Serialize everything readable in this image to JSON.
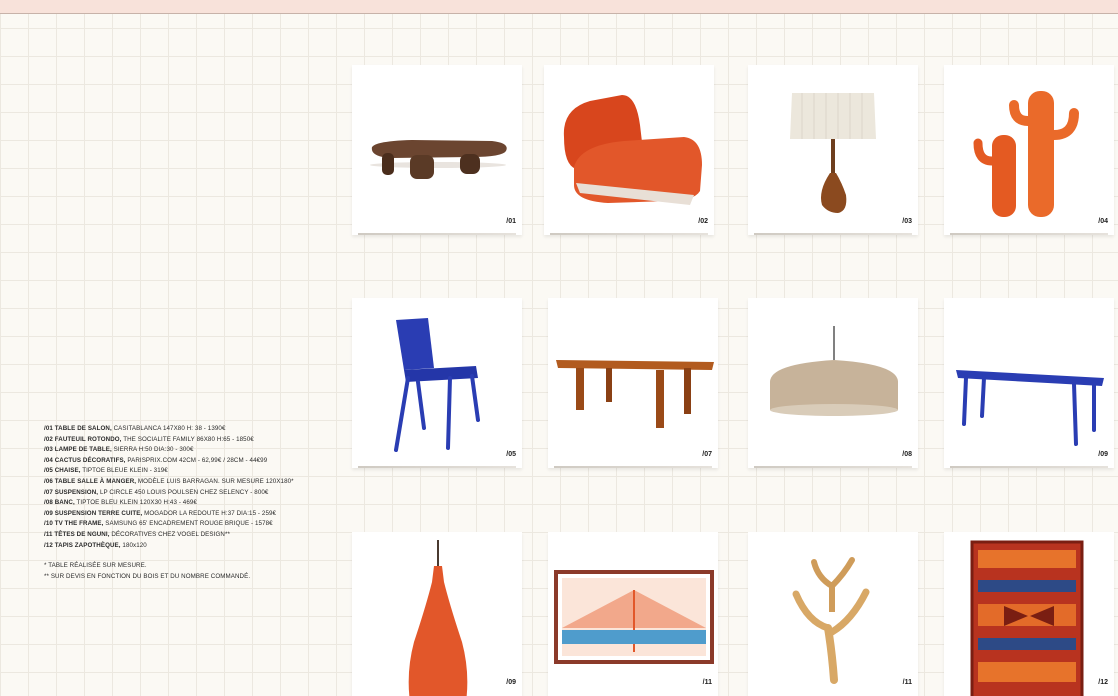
{
  "products": [
    {
      "num": "/01",
      "icon": "coffee-table-icon"
    },
    {
      "num": "/02",
      "icon": "armchair-icon"
    },
    {
      "num": "/03",
      "icon": "table-lamp-icon"
    },
    {
      "num": "/04",
      "icon": "cactus-decor-icon"
    },
    {
      "num": "/05",
      "icon": "chair-icon"
    },
    {
      "num": "/07",
      "icon": "dining-table-icon"
    },
    {
      "num": "/08",
      "icon": "pendant-lamp-icon"
    },
    {
      "num": "/09",
      "icon": "bench-icon"
    },
    {
      "num": "/09",
      "icon": "terracotta-pendant-icon"
    },
    {
      "num": "/11",
      "icon": "tv-frame-icon"
    },
    {
      "num": "/11",
      "icon": "nguni-horns-icon"
    },
    {
      "num": "/12",
      "icon": "zapotec-rug-icon"
    }
  ],
  "legend": [
    {
      "bold": "/01 TABLE DE SALON,",
      "text": " CASITABLANCA 147X80 H: 38 - 1390€"
    },
    {
      "bold": "/02 FAUTEUIL ROTONDO,",
      "text": " THE SOCIALITE FAMILY 86X80 H:65 - 1850€"
    },
    {
      "bold": "/03 LAMPE DE TABLE,",
      "text": " SIERRA H:50 DIA:30 - 300€"
    },
    {
      "bold": "/04 CACTUS DÉCORATIFS,",
      "text": " PARISPRIX.COM 42CM - 62,99€ / 28CM - 44€99"
    },
    {
      "bold": "/05 CHAISE,",
      "text": " TIPTOE BLEUE KLEIN - 319€"
    },
    {
      "bold": "/06 TABLE SALLE À MANGER,",
      "text": " MODÈLE LUIS BARRAGAN. SUR MESURE 120X180*"
    },
    {
      "bold": "/07 SUSPENSION,",
      "text": " LP CIRCLE 450 LOUIS POULSEN CHEZ SELENCY - 800€"
    },
    {
      "bold": "/08 BANC,",
      "text": " TIPTOE BLEU KLEIN 120X30 H:43 - 469€"
    },
    {
      "bold": "/09 SUSPENSION TERRE CUITE,",
      "text": " MOGADOR  LA REDOUTE H:37 DIA:15 - 259€"
    },
    {
      "bold": "/10 TV THE FRAME,",
      "text": " SAMSUNG 65' ENCADREMENT ROUGE BRIQUE - 1578€"
    },
    {
      "bold": "/11 TÊTES DE NGUNI,",
      "text": " DÉCORATIVES CHEZ VOGEL DESIGN**"
    },
    {
      "bold": "/12 TAPIS ZAPOTHÈQUE,",
      "text": " 180x120"
    }
  ],
  "notes": [
    " * TABLE RÉALISÉE SUR MESURE.",
    "** SUR DEVIS EN FONCTION DU BOIS ET DU NOMBRE COMMANDÉ."
  ],
  "colors": {
    "background": "#fbf9f4",
    "grid": "#ece8e0",
    "topbar": "#f8e2da",
    "klein_blue": "#2a3db3",
    "terracotta": "#e2572a",
    "wood": "#9a5a2c"
  }
}
